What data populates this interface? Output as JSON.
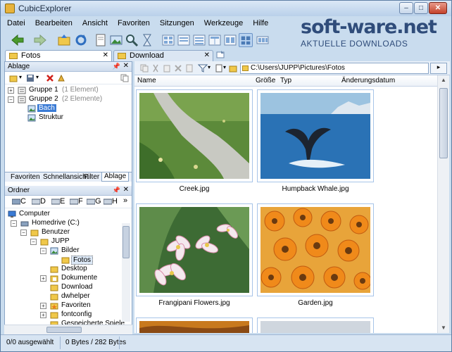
{
  "window": {
    "title": "CubicExplorer",
    "min": "–",
    "max": "□",
    "close": "✕"
  },
  "menu": [
    "Datei",
    "Bearbeiten",
    "Ansicht",
    "Favoriten",
    "Sitzungen",
    "Werkzeuge",
    "Hilfe"
  ],
  "watermark": {
    "brand": "soft-ware.net",
    "tagline": "AKTUELLE DOWNLOADS"
  },
  "tabs": [
    {
      "label": "Fotos",
      "close": "✕"
    },
    {
      "label": "Download",
      "close": "✕"
    }
  ],
  "ablage": {
    "title": "Ablage",
    "pin": "📌",
    "close": "✕",
    "items": [
      {
        "label": "Gruppe 1",
        "note": "(1 Element)",
        "exp": "+"
      },
      {
        "label": "Gruppe 2",
        "note": "(2 Elemente)",
        "exp": "−"
      },
      {
        "label": "Bach"
      },
      {
        "label": "Struktur"
      }
    ]
  },
  "bottom_tabs": [
    "Favoriten",
    "Schnellansicht",
    "Filter",
    "Ablage"
  ],
  "ordner": {
    "title": "Ordner",
    "pin": "📌",
    "close": "✕",
    "drives": [
      "C",
      "D",
      "E",
      "F",
      "G",
      "H"
    ],
    "more": "»",
    "tree": [
      {
        "label": "Computer",
        "depth": 0,
        "exp": ""
      },
      {
        "label": "Homedrive (C:)",
        "depth": 1,
        "exp": "−"
      },
      {
        "label": "Benutzer",
        "depth": 2,
        "exp": "−"
      },
      {
        "label": "JUPP",
        "depth": 3,
        "exp": "−"
      },
      {
        "label": "Bilder",
        "depth": 4,
        "exp": "−"
      },
      {
        "label": "Fotos",
        "depth": 5,
        "exp": ""
      },
      {
        "label": "Desktop",
        "depth": 4,
        "exp": ""
      },
      {
        "label": "Dokumente",
        "depth": 4,
        "exp": "+"
      },
      {
        "label": "Download",
        "depth": 4,
        "exp": ""
      },
      {
        "label": "dwhelper",
        "depth": 4,
        "exp": ""
      },
      {
        "label": "Favoriten",
        "depth": 4,
        "exp": "+"
      },
      {
        "label": "fontconfig",
        "depth": 4,
        "exp": "+"
      },
      {
        "label": "Gespeicherte Spiele",
        "depth": 4,
        "exp": ""
      }
    ]
  },
  "address": {
    "path": "C:\\Users\\JUPP\\Pictures\\Fotos",
    "go": "▸"
  },
  "columns": [
    "Name",
    "Größe",
    "Typ",
    "Änderungsdatum"
  ],
  "files": [
    {
      "name": "Creek.jpg"
    },
    {
      "name": "Humpback Whale.jpg"
    },
    {
      "name": "Frangipani Flowers.jpg"
    },
    {
      "name": "Garden.jpg"
    }
  ],
  "status": {
    "selected": "0/0 ausgewählt",
    "size": "0 Bytes / 282 Bytes"
  }
}
